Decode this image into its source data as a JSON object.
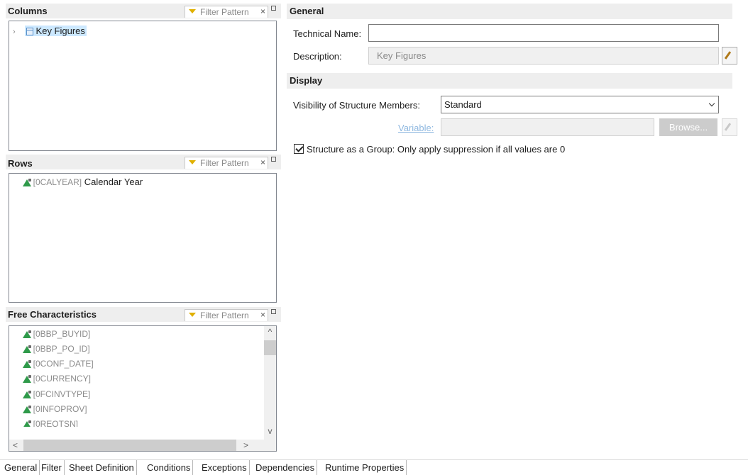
{
  "columns": {
    "title": "Columns",
    "filter_placeholder": "Filter Pattern",
    "items": [
      {
        "label": "Key Figures"
      }
    ]
  },
  "rows": {
    "title": "Rows",
    "filter_placeholder": "Filter Pattern",
    "items": [
      {
        "code": "[0CALYEAR]",
        "label": "Calendar Year"
      }
    ]
  },
  "free": {
    "title": "Free Characteristics",
    "filter_placeholder": "Filter Pattern",
    "items": [
      {
        "code": "[0BBP_BUYID]"
      },
      {
        "code": "[0BBP_PO_ID]"
      },
      {
        "code": "[0CONF_DATE]"
      },
      {
        "code": "[0CURRENCY]"
      },
      {
        "code": "[0FCINVTYPE]"
      },
      {
        "code": "[0INFOPROV]"
      },
      {
        "code": "[0REQTSN]"
      }
    ]
  },
  "general": {
    "title": "General",
    "technical_name_label": "Technical Name:",
    "technical_name_value": "",
    "description_label": "Description:",
    "description_value": "Key Figures"
  },
  "display": {
    "title": "Display",
    "visibility_label": "Visibility of Structure Members:",
    "visibility_value": "Standard",
    "variable_label": "Variable:",
    "variable_value": "",
    "browse_label": "Browse...",
    "group_checkbox_label": "Structure as a Group: Only apply suppression if all values are 0",
    "group_checked": true
  },
  "tabs": [
    {
      "label": "General"
    },
    {
      "label": "Filter"
    },
    {
      "label": "Sheet Definition"
    },
    {
      "label": "Conditions"
    },
    {
      "label": "Exceptions"
    },
    {
      "label": "Dependencies"
    },
    {
      "label": "Runtime Properties"
    }
  ],
  "icons": {
    "expand": "chevron-right-icon",
    "structure": "structure-icon",
    "characteristic": "characteristic-icon",
    "filter": "funnel-icon",
    "close": "close-icon",
    "maximize": "maximize-icon",
    "edit": "pencil-icon"
  }
}
